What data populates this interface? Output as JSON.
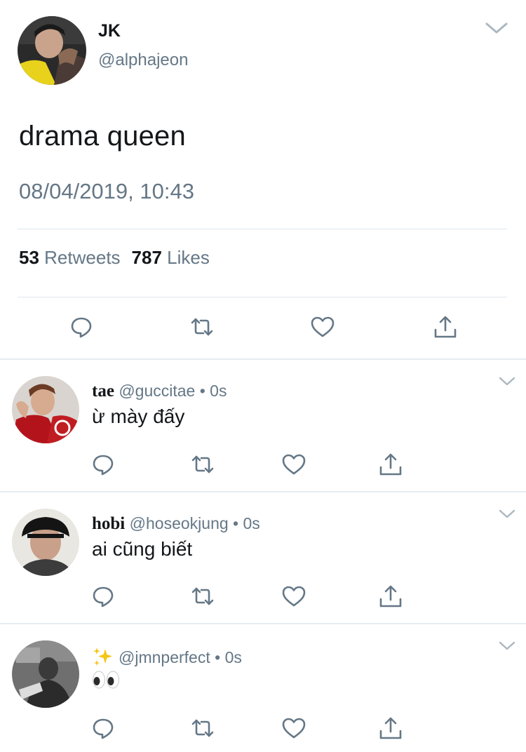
{
  "main_tweet": {
    "display_name": "JK",
    "handle": "@alphajeon",
    "text": "drama queen",
    "timestamp": "08/04/2019, 10:43",
    "retweets_count": "53",
    "retweets_label": "Retweets",
    "likes_count": "787",
    "likes_label": "Likes",
    "avatar_icon": "profile-photo",
    "actions": [
      "reply-icon",
      "retweet-icon",
      "like-icon",
      "share-icon"
    ]
  },
  "replies": [
    {
      "name": "tae",
      "handle": "@guccitae",
      "separator": "•",
      "time": "0s",
      "text": "ừ mày đấy"
    },
    {
      "name": "hobi",
      "handle": "@hoseokjung",
      "separator": "•",
      "time": "0s",
      "text": "ai cũng biết"
    },
    {
      "name_emoji": "sparkles-emoji",
      "handle": "@jmnperfect",
      "separator": "•",
      "time": "0s",
      "text_emoji": "eyes-emoji"
    }
  ],
  "colors": {
    "primary_text": "#14171a",
    "secondary_text": "#657786",
    "icon": "#657786",
    "divider": "#e1e8ed"
  }
}
